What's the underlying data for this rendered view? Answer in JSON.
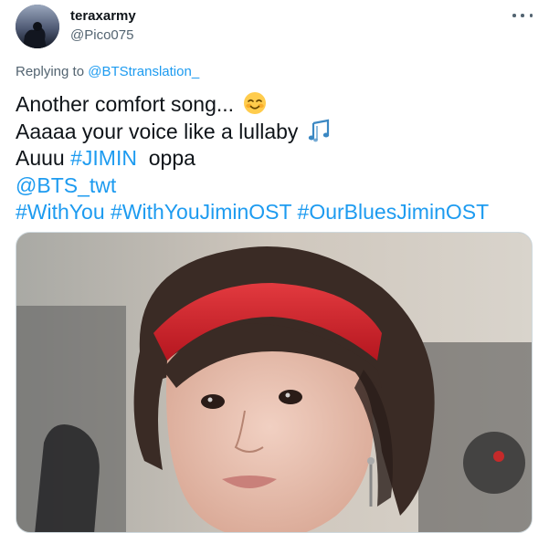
{
  "tweet": {
    "display_name": "teraxarmy",
    "handle": "@Pico075",
    "replying_to_prefix": "Replying to ",
    "replying_to_handle": "@BTStranslation_",
    "lines": {
      "l1_text": "Another comfort song...",
      "l2_text": "Aaaaa your voice like a lullaby",
      "l3_prefix": "Auuu ",
      "l3_hashtag": "#JIMIN",
      "l3_suffix": "  oppa",
      "l4_mention": "@BTS_twt",
      "l5_tag1": "#WithYou",
      "l5_tag2": "#WithYouJiminOST",
      "l5_tag3": "#OurBluesJiminOST"
    },
    "icons": {
      "more": "more-horizontal-icon",
      "emoji1": "smiling-face-with-smiling-eyes-emoji",
      "emoji2": "musical-notes-emoji"
    },
    "colors": {
      "link": "#1d9bf0",
      "secondary_text": "#536471",
      "primary_text": "#0f1419"
    }
  }
}
